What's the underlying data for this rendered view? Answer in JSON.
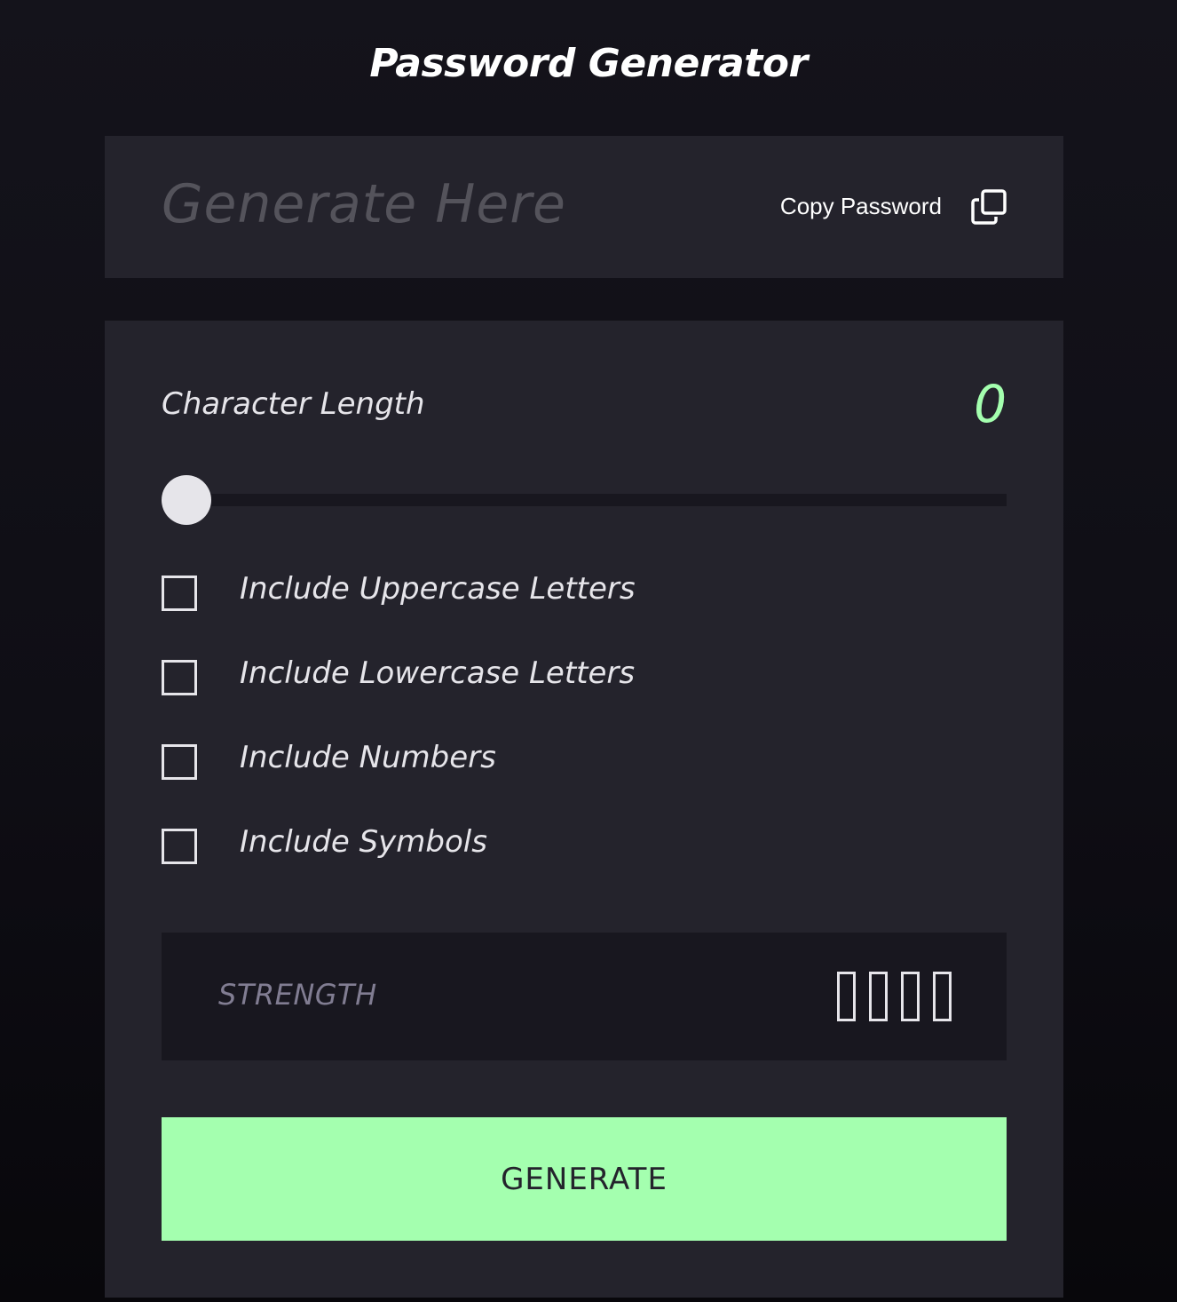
{
  "header": {
    "title": "Password Generator"
  },
  "output": {
    "placeholder": "Generate Here",
    "copy_label": "Copy Password",
    "copy_icon": "copy-icon"
  },
  "settings": {
    "length_label": "Character Length",
    "length_value": "0",
    "slider_value_fraction": 0,
    "options": [
      {
        "label": "Include Uppercase Letters",
        "checked": false
      },
      {
        "label": "Include Lowercase Letters",
        "checked": false
      },
      {
        "label": "Include Numbers",
        "checked": false
      },
      {
        "label": "Include Symbols",
        "checked": false
      }
    ]
  },
  "strength": {
    "label": "STRENGTH",
    "level": 0,
    "bar_count": 4
  },
  "actions": {
    "generate_label": "GENERATE"
  },
  "colors": {
    "accent": "#a4ffaf",
    "panel": "#24232c",
    "inset": "#18171f",
    "text": "#e6e5ea",
    "muted": "#817d92",
    "placeholder": "#54535b"
  }
}
